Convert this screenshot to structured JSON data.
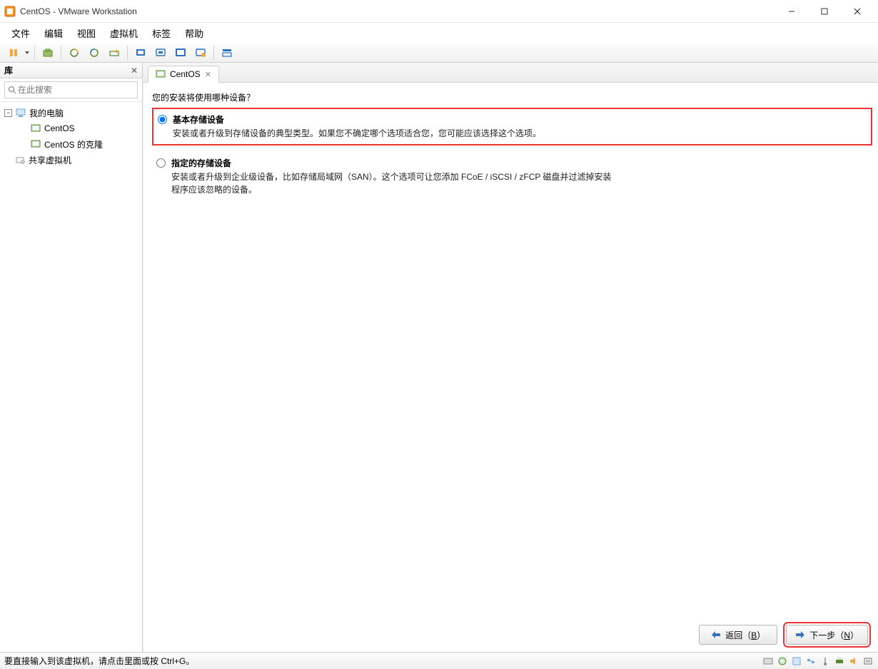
{
  "window": {
    "title": "CentOS - VMware Workstation"
  },
  "menu": {
    "file": "文件",
    "edit": "编辑",
    "view": "视图",
    "vm": "虚拟机",
    "tabs": "标签",
    "help": "帮助"
  },
  "sidebar": {
    "header": "库",
    "search_placeholder": "在此搜索",
    "root": "我的电脑",
    "items": [
      "CentOS",
      "CentOS 的克隆"
    ],
    "shared": "共享虚拟机"
  },
  "tab": {
    "label": "CentOS"
  },
  "installer": {
    "question": "您的安装将使用哪种设备？",
    "opt1": {
      "title": "基本存储设备",
      "desc": "安装或者升级到存储设备的典型类型。如果您不确定哪个选项适合您，您可能应该选择这个选项。"
    },
    "opt2": {
      "title": "指定的存储设备",
      "desc": "安装或者升级到企业级设备，比如存储局域网（SAN）。这个选项可让您添加 FCoE / iSCSI / zFCP 磁盘并过滤掉安装程序应该忽略的设备。"
    },
    "back": "返回（",
    "back_key": "B",
    "back_tail": "）",
    "next": "下一步（",
    "next_key": "N",
    "next_tail": "）"
  },
  "status": {
    "text": "要直接输入到该虚拟机，请点击里面或按 Ctrl+G。"
  }
}
